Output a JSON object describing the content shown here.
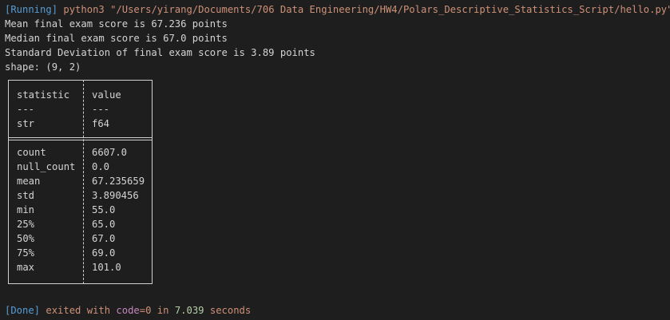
{
  "output": {
    "running_tag": "[Running]",
    "command": " python3 \"/Users/yirang/Documents/706 Data Engineering/HW4/Polars_Descriptive_Statistics_Script/hello.py\"",
    "lines": [
      "Mean final exam score is 67.236 points",
      "Median final exam score is 67.0 points",
      "Standard Deviation of final exam score is 3.89 points",
      "shape: (9, 2)"
    ]
  },
  "table": {
    "headers": [
      "statistic",
      "value"
    ],
    "separators": [
      "---",
      "---"
    ],
    "dtypes": [
      "str",
      "f64"
    ],
    "rows": [
      [
        "count",
        "6607.0"
      ],
      [
        "null_count",
        "0.0"
      ],
      [
        "mean",
        "67.235659"
      ],
      [
        "std",
        "3.890456"
      ],
      [
        "min",
        "55.0"
      ],
      [
        "25%",
        "65.0"
      ],
      [
        "50%",
        "67.0"
      ],
      [
        "75%",
        "69.0"
      ],
      [
        "max",
        "101.0"
      ]
    ]
  },
  "done": {
    "tag": "[Done]",
    "text1": " exited with ",
    "code_label": "code",
    "code_value": "=0",
    "text2": " in ",
    "seconds": "7.039",
    "text3": " seconds"
  },
  "colors": {
    "background": "#1e1e1e",
    "tag_blue": "#569cd6",
    "string_orange": "#ce9178",
    "keyword_purple": "#c586c0",
    "number_green": "#b5cea8"
  }
}
